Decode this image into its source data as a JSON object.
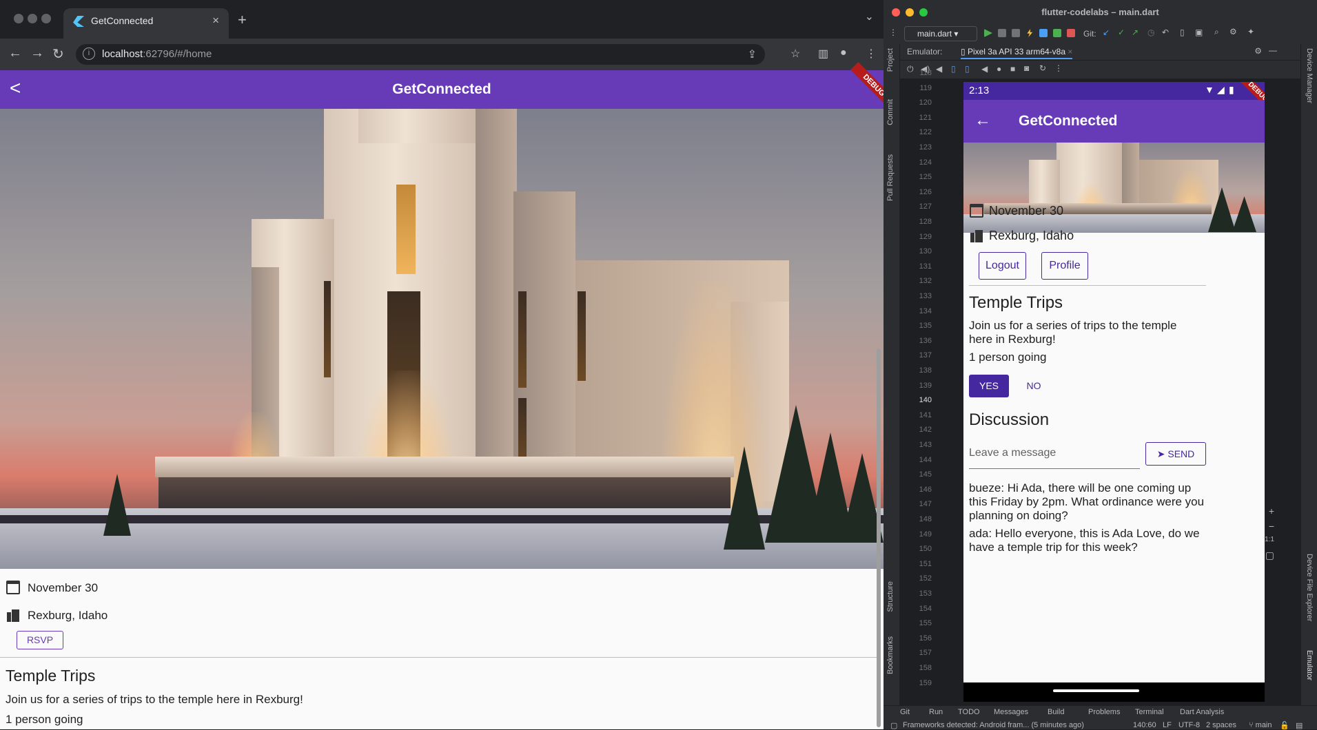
{
  "browser": {
    "tab_title": "GetConnected",
    "tab_close": "×",
    "new_tab": "+",
    "url_host": "localhost",
    "url_rest": ":62796/#/home"
  },
  "web_app": {
    "title": "GetConnected",
    "debug_banner": "DEBUG",
    "date": "November 30",
    "location": "Rexburg, Idaho",
    "rsvp_label": "RSVP",
    "event_title": "Temple Trips",
    "event_description": "Join us for a series of trips to the temple here in Rexburg!",
    "attendance": "1 person going"
  },
  "studio": {
    "window_title": "flutter-codelabs – main.dart",
    "run_config": "main.dart",
    "git_label": "Git:",
    "emulator_label": "Emulator:",
    "device_tab": "Pixel 3a API 33 arm64-v8a",
    "side_left": [
      "Project",
      "Commit",
      "Pull Requests",
      "Structure",
      "Bookmarks"
    ],
    "side_right": [
      "Device Manager",
      "Device File Explorer",
      "Emulator"
    ],
    "line_numbers": [
      "118",
      "119",
      "120",
      "121",
      "122",
      "123",
      "124",
      "125",
      "126",
      "127",
      "128",
      "129",
      "130",
      "131",
      "132",
      "133",
      "134",
      "135",
      "136",
      "137",
      "138",
      "139",
      "140",
      "141",
      "142",
      "143",
      "144",
      "145",
      "146",
      "147",
      "148",
      "149",
      "150",
      "151",
      "152",
      "153",
      "154",
      "155",
      "156",
      "157",
      "158",
      "159"
    ],
    "current_line": "140",
    "zoom_ratio": "1:1",
    "bottom_tools": [
      "Git",
      "Run",
      "TODO",
      "Messages",
      "Build",
      "Problems",
      "Terminal",
      "Dart Analysis"
    ],
    "status_message": "Frameworks detected: Android fram... (5 minutes ago)",
    "cursor_pos": "140:60",
    "line_sep": "LF",
    "encoding": "UTF-8",
    "indent": "2 spaces",
    "branch": "main"
  },
  "phone": {
    "time": "2:13",
    "debug_banner": "DEBUG",
    "title": "GetConnected",
    "date": "November 30",
    "location": "Rexburg, Idaho",
    "logout_label": "Logout",
    "profile_label": "Profile",
    "event_title": "Temple Trips",
    "event_description": "Join us for a series of trips to the temple here in Rexburg!",
    "attendance": "1 person going",
    "yes_label": "YES",
    "no_label": "NO",
    "discussion_title": "Discussion",
    "message_placeholder": "Leave a message",
    "send_label": "SEND",
    "messages": [
      "bueze: Hi Ada, there will be one coming up this Friday by 2pm. What ordinance were you planning on doing?",
      "ada: Hello everyone, this is Ada Love, do we have a temple trip for this week?"
    ]
  },
  "colors": {
    "primary": "#673ab7",
    "primary_dark": "#4527a0",
    "debug": "#b71c1c"
  }
}
